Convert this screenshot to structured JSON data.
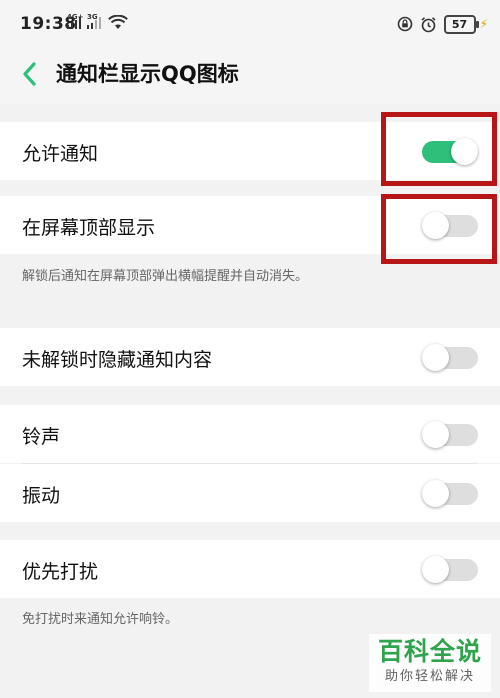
{
  "status_bar": {
    "time": "19:38",
    "network1": "4G+",
    "network2": "3G",
    "battery": "57",
    "icons": [
      "signal-icon",
      "signal-icon",
      "wifi-icon",
      "lock-rotation-icon",
      "alarm-icon",
      "battery-icon",
      "charging-icon"
    ]
  },
  "header": {
    "title": "通知栏显示QQ图标"
  },
  "settings": {
    "allow_notifications": {
      "label": "允许通知",
      "enabled": true
    },
    "show_on_top": {
      "label": "在屏幕顶部显示",
      "enabled": false
    },
    "show_on_top_hint": "解锁后通知在屏幕顶部弹出横幅提醒并自动消失。",
    "hide_when_locked": {
      "label": "未解锁时隐藏通知内容",
      "enabled": false
    },
    "ringtone": {
      "label": "铃声",
      "enabled": false
    },
    "vibrate": {
      "label": "振动",
      "enabled": false
    },
    "priority_dnd": {
      "label": "优先打扰",
      "enabled": false
    },
    "priority_dnd_hint": "免打扰时来通知允许响铃。"
  },
  "colors": {
    "accent": "#2ebf7b",
    "highlight": "#b81616",
    "background": "#f2f2f2"
  },
  "watermark": {
    "main": "百科全说",
    "sub": "助你轻松解决"
  }
}
